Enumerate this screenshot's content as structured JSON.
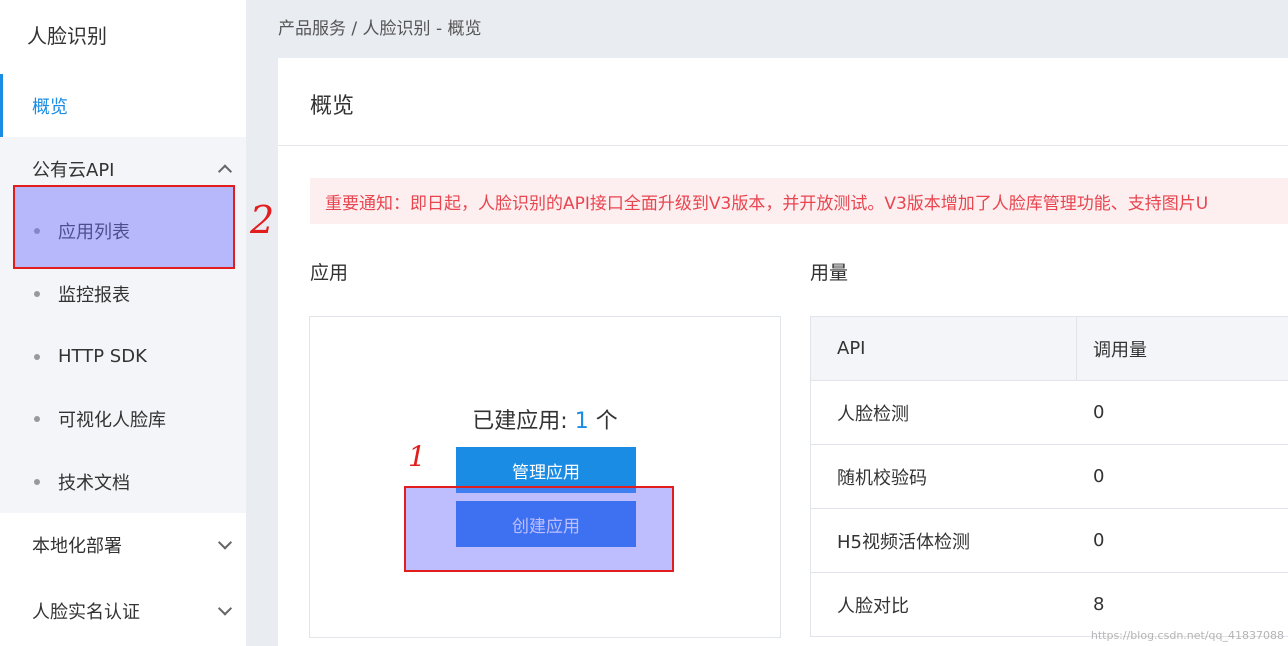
{
  "sidebar": {
    "title": "人脸识别",
    "overview": "概览",
    "public_cloud_group": "公有云API",
    "sub_items": [
      "应用列表",
      "监控报表",
      "HTTP SDK",
      "可视化人脸库",
      "技术文档"
    ],
    "local_deploy": "本地化部署",
    "realname_auth": "人脸实名认证"
  },
  "breadcrumb": "产品服务 / 人脸识别 - 概览",
  "main": {
    "title": "概览",
    "notice": "重要通知：即日起，人脸识别的API接口全面升级到V3版本，并开放测试。V3版本增加了人脸库管理功能、支持图片U",
    "apps": {
      "section_title": "应用",
      "count_prefix": "已建应用: ",
      "count": "1",
      "count_suffix": " 个",
      "manage_button": "管理应用",
      "create_button": "创建应用"
    },
    "usage": {
      "section_title": "用量",
      "headers": [
        "API",
        "调用量"
      ],
      "rows": [
        {
          "api": "人脸检测",
          "calls": "0"
        },
        {
          "api": "随机校验码",
          "calls": "0"
        },
        {
          "api": "H5视频活体检测",
          "calls": "0"
        },
        {
          "api": "人脸对比",
          "calls": "8"
        }
      ]
    }
  },
  "annotations": {
    "num1": "1",
    "num2": "2"
  },
  "watermark": "https://blog.csdn.net/qq_41837088",
  "colors": {
    "accent": "#1b8ce4",
    "notice_text": "#e8454f",
    "annotation_red": "#e11d1d"
  }
}
